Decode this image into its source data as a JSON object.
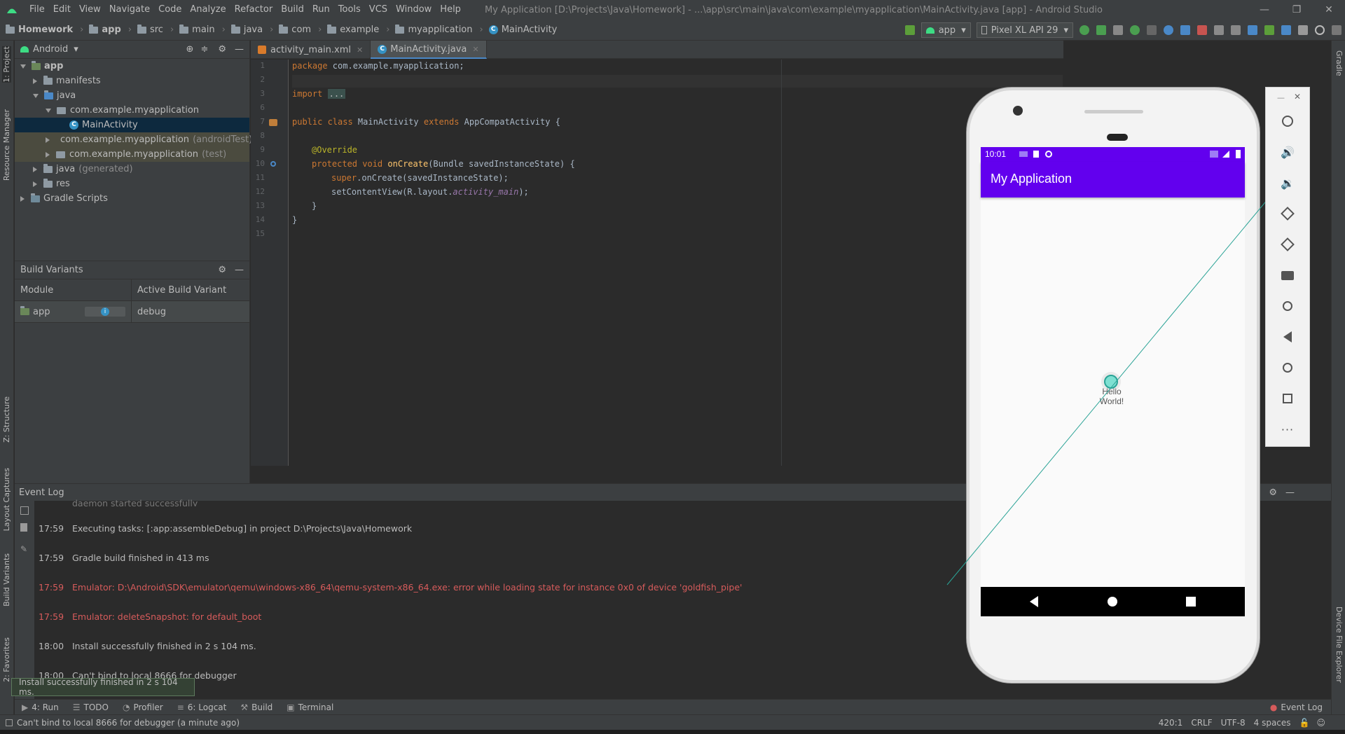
{
  "app": {
    "menus": [
      "File",
      "Edit",
      "View",
      "Navigate",
      "Code",
      "Analyze",
      "Refactor",
      "Build",
      "Run",
      "Tools",
      "VCS",
      "Window",
      "Help"
    ],
    "window_title": "My Application [D:\\Projects\\Java\\Homework] - ...\\app\\src\\main\\java\\com\\example\\myapplication\\MainActivity.java [app] - Android Studio"
  },
  "breadcrumb": [
    "Homework",
    "app",
    "src",
    "main",
    "java",
    "com",
    "example",
    "myapplication",
    "MainActivity"
  ],
  "toolbar": {
    "run_config": "app",
    "device": "Pixel XL API 29"
  },
  "project_panel": {
    "view_mode": "Android",
    "tree": [
      {
        "label": "app",
        "suffix": ""
      },
      {
        "label": "manifests",
        "suffix": ""
      },
      {
        "label": "java",
        "suffix": ""
      },
      {
        "label": "com.example.myapplication",
        "suffix": ""
      },
      {
        "label": "MainActivity",
        "suffix": ""
      },
      {
        "label": "com.example.myapplication",
        "suffix": "(androidTest)"
      },
      {
        "label": "com.example.myapplication",
        "suffix": "(test)"
      },
      {
        "label": "java",
        "suffix": "(generated)"
      },
      {
        "label": "res",
        "suffix": ""
      },
      {
        "label": "Gradle Scripts",
        "suffix": ""
      }
    ]
  },
  "build_variants": {
    "title": "Build Variants",
    "col_module": "Module",
    "col_variant": "Active Build Variant",
    "row_module": "app",
    "row_variant": "debug"
  },
  "editor": {
    "tabs": [
      "activity_main.xml",
      "MainActivity.java"
    ],
    "line_numbers": [
      "1",
      "2",
      "3",
      "6",
      "7",
      "8",
      "9",
      "10",
      "11",
      "12",
      "13",
      "14",
      "15"
    ],
    "code": {
      "l1a": "package",
      "l1b": " com.example.myapplication;",
      "l3a": "import",
      "l3b": "...",
      "l7a": "public class",
      "l7b": " MainActivity ",
      "l7c": "extends",
      "l7d": " AppCompatActivity {",
      "l9": "@Override",
      "l10a": "protected void",
      "l10b": "onCreate",
      "l10c": "(Bundle savedInstanceState) {",
      "l11a": "super",
      "l11b": ".onCreate(savedInstanceState);",
      "l12a": "setContentView(R.layout.",
      "l12b": "activity_main",
      "l12c": ");",
      "l13": "}",
      "l14": "}"
    }
  },
  "event_log": {
    "title": "Event Log",
    "partial_top": "daemon started successfully",
    "entries": [
      {
        "time": "17:59",
        "text": "Executing tasks: [:app:assembleDebug] in project D:\\Projects\\Java\\Homework",
        "level": "info"
      },
      {
        "time": "17:59",
        "text": "Gradle build finished in 413 ms",
        "level": "info"
      },
      {
        "time": "17:59",
        "text": "Emulator: D:\\Android\\SDK\\emulator\\qemu\\windows-x86_64\\qemu-system-x86_64.exe: error while loading state for instance 0x0 of device 'goldfish_pipe'",
        "level": "error"
      },
      {
        "time": "17:59",
        "text": "Emulator: deleteSnapshot: for default_boot",
        "level": "error"
      },
      {
        "time": "18:00",
        "text": "Install successfully finished in 2 s 104 ms.",
        "level": "info"
      },
      {
        "time": "18:00",
        "text": "Can't bind to local 8666 for debugger",
        "level": "info"
      }
    ]
  },
  "balloon": "Install successfully finished in 2 s 104 ms.",
  "bottom_tools": {
    "run": "4: Run",
    "todo": "TODO",
    "profiler": "Profiler",
    "logcat": "6: Logcat",
    "build": "Build",
    "terminal": "Terminal",
    "event_log": "Event Log"
  },
  "status_bar": {
    "message": "Can't bind to local 8666 for debugger (a minute ago)",
    "position": "420:1",
    "line_sep": "CRLF",
    "encoding": "UTF-8",
    "indent": "4 spaces"
  },
  "side_tabs": {
    "left": [
      "1: Project",
      "Resource Manager",
      "Z: Structure",
      "Layout Captures",
      "Build Variants",
      "2: Favorites"
    ],
    "right": [
      "Gradle",
      "Device File Explorer"
    ]
  },
  "emulator": {
    "time": "10:01",
    "app_title": "My Application",
    "body_text": "Hello World!",
    "accent": "#6200ee"
  },
  "colors": {
    "ide_bg": "#2b2b2b",
    "panel_bg": "#3c3f41",
    "error_text": "#d65b5b",
    "selection": "#0d293e"
  }
}
